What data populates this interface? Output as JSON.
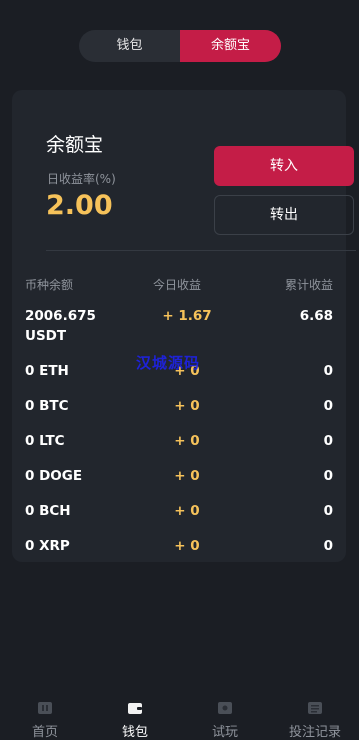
{
  "segment": {
    "tabs": [
      {
        "label": "钱包",
        "active": false
      },
      {
        "label": "余额宝",
        "active": true
      }
    ]
  },
  "card": {
    "title": "余额宝",
    "rate_label": "日收益率(%)",
    "rate_value": "2.00",
    "transfer_in": "转入",
    "transfer_out": "转出"
  },
  "table": {
    "headers": [
      "币种余额",
      "今日收益",
      "累计收益"
    ],
    "rows": [
      {
        "balance": "2006.675 USDT",
        "today": "+ 1.67",
        "total": "6.68"
      },
      {
        "balance": "0 ETH",
        "today": "+ 0",
        "total": "0"
      },
      {
        "balance": "0 BTC",
        "today": "+ 0",
        "total": "0"
      },
      {
        "balance": "0 LTC",
        "today": "+ 0",
        "total": "0"
      },
      {
        "balance": "0 DOGE",
        "today": "+ 0",
        "total": "0"
      },
      {
        "balance": "0 BCH",
        "today": "+ 0",
        "total": "0"
      },
      {
        "balance": "0 XRP",
        "today": "+ 0",
        "total": "0"
      }
    ]
  },
  "watermark": "汉城源码",
  "tabbar": {
    "items": [
      {
        "label": "首页",
        "icon": "home-icon",
        "active": false
      },
      {
        "label": "钱包",
        "icon": "wallet-icon",
        "active": true
      },
      {
        "label": "试玩",
        "icon": "play-icon",
        "active": false
      },
      {
        "label": "投注记录",
        "icon": "record-icon",
        "active": false
      }
    ]
  },
  "colors": {
    "accent": "#c41d47",
    "gold": "#f6c25a",
    "background": "#1b1e24",
    "card": "#22262d"
  }
}
